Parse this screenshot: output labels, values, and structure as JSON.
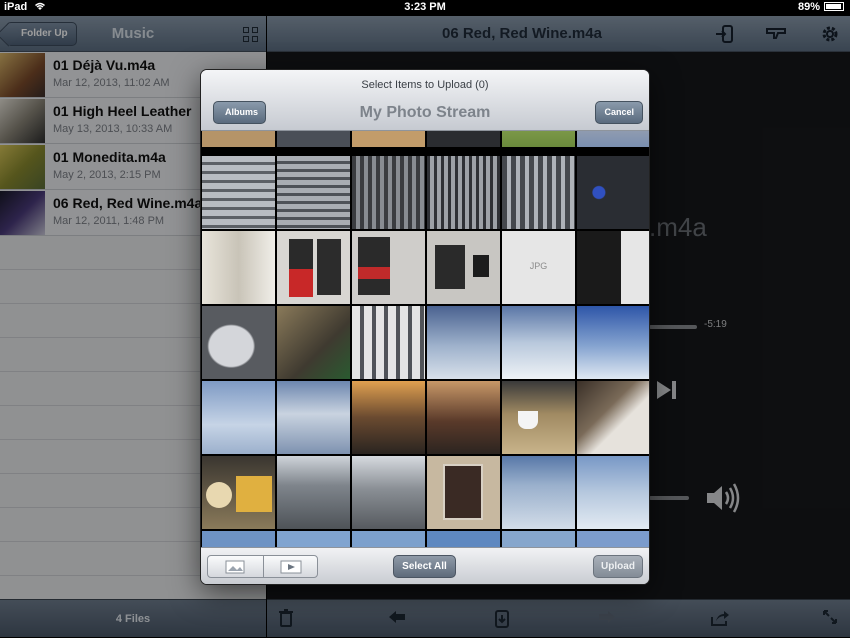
{
  "status_bar": {
    "device": "iPad",
    "time": "3:23 PM",
    "battery": "89%"
  },
  "left_panel": {
    "back_label": "Folder Up",
    "title": "Music",
    "files": [
      {
        "name": "01 Déjà Vu.m4a",
        "date": "Mar 12, 2013, 11:02 AM",
        "art": "#9a7a5a"
      },
      {
        "name": "01 High Heel Leather",
        "date": "May 13, 2013, 10:33 AM",
        "art": "#c8c2b6"
      },
      {
        "name": "01 Monedita.m4a",
        "date": "May 2, 2013, 2:15 PM",
        "art": "#b6a640"
      },
      {
        "name": "06 Red, Red Wine.m4a",
        "date": "Mar 12, 2011, 1:48 PM",
        "art": "#2a2a4a"
      }
    ],
    "footer": "4 Files"
  },
  "right_panel": {
    "title": "06 Red, Red Wine.m4a",
    "big_title": ".m4a",
    "remaining": "-5:19"
  },
  "modal": {
    "subtitle": "Select Items to Upload (0)",
    "title": "My Photo Stream",
    "back_label": "Albums",
    "cancel_label": "Cancel",
    "select_all_label": "Select All",
    "upload_label": "Upload",
    "jpg_label": "JPG",
    "photos": [
      [
        "#b59468",
        "#4a4f57",
        "#c29c6a",
        "#2a2c30",
        "#6b8a3c",
        "#c0a48a"
      ],
      [
        "#9aa0a8",
        "#8a8f96",
        "#55585d",
        "#6c6f74",
        "#7a7d82",
        "#3b4a6a"
      ],
      [
        "#d4d2cc",
        "#3b3d42",
        "#a3a39f",
        "#8c8a86",
        "#e4e4e4",
        "#2c2c2c"
      ],
      [
        "#585b60",
        "#6d6455",
        "#9fa2a6",
        "#6f84a6",
        "#8ea3c2",
        "#5d7db8"
      ],
      [
        "#9db1ce",
        "#8c9fba",
        "#6a4c34",
        "#7a5a3c",
        "#b49a70",
        "#5a4e44"
      ],
      [
        "#7a6c4a",
        "#a8acb2",
        "#9aa0a6",
        "#a48c6c",
        "#5e86ae",
        "#6d8fbc"
      ],
      [
        "#6e93c4",
        "#80a4d0",
        "#7ca0cc",
        "#5e88c0",
        "#86a6cc",
        "#7c9ccc"
      ]
    ]
  }
}
